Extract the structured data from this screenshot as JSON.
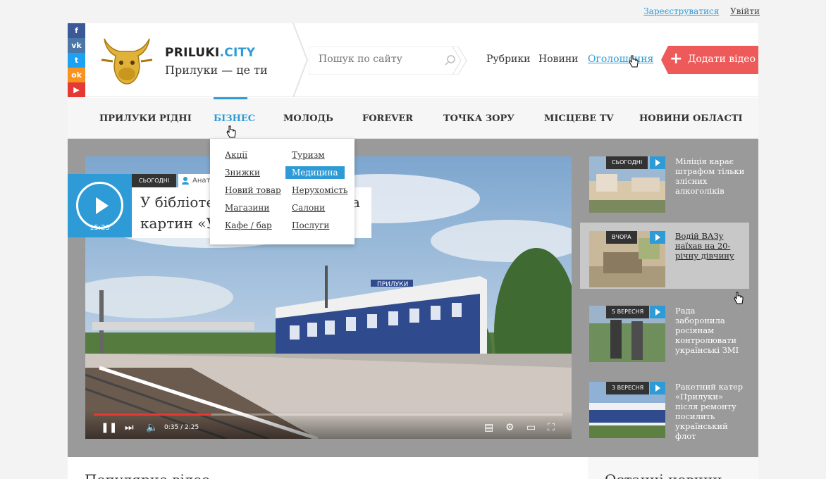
{
  "auth": {
    "register": "Зареєструватися",
    "login": "Увійти"
  },
  "social": [
    "f",
    "vk",
    "tw",
    "ok",
    "yt"
  ],
  "header": {
    "brand_main": "PRILUKI",
    "brand_accent": ".CITY",
    "tagline": "Прилуки — це ти",
    "search_placeholder": "Пошук по сайту",
    "links": [
      "Рубрики",
      "Новини",
      "Оголошення"
    ],
    "add_video": "Додати відео"
  },
  "mainnav": [
    "ПРИЛУКИ РІДНІ",
    "БІЗНЕС",
    "МОЛОДЬ",
    "FOREVER",
    "ТОЧКА ЗОРУ",
    "МІСЦЕВЕ TV",
    "НОВИНИ ОБЛАСТІ"
  ],
  "dropdown": {
    "col1": [
      "Акції",
      "Знижки",
      "Новий товар",
      "Магазини",
      "Кафе / бар"
    ],
    "col2": [
      "Туризм",
      "Медицина",
      "Нерухомість",
      "Салони",
      "Послуги"
    ],
    "selected": "Медицина"
  },
  "featured": {
    "tag": "СЬОГОДНІ",
    "author": "Анат",
    "headline_line1": "У бібліоте",
    "headline_tail": "а",
    "headline_line2": "картин «У",
    "duration": "15:23",
    "player_time": "0:35 / 2:25",
    "progress": 0.25,
    "station_sign": "ПРИЛУКИ"
  },
  "sidebar": [
    {
      "tag": "СЬОГОДНІ",
      "title": "Міліція карає штрафом тільки злісних алкоголіків"
    },
    {
      "tag": "ВЧОРА",
      "title": "Водій ВАЗу наїхав на 20-річну дівчину"
    },
    {
      "tag": "5 ВЕРЕСНЯ",
      "title": "Рада заборонила росіянам контролювати українські ЗМІ"
    },
    {
      "tag": "3 ВЕРЕСНЯ",
      "title": "Ракетний катер «Прилуки» після ремонту посилить український флот"
    }
  ],
  "bottom": {
    "popular": "Популярне відео",
    "latest": "Останні новини"
  },
  "colors": {
    "accent": "#2e9bd6",
    "cta": "#ee5a5a"
  }
}
